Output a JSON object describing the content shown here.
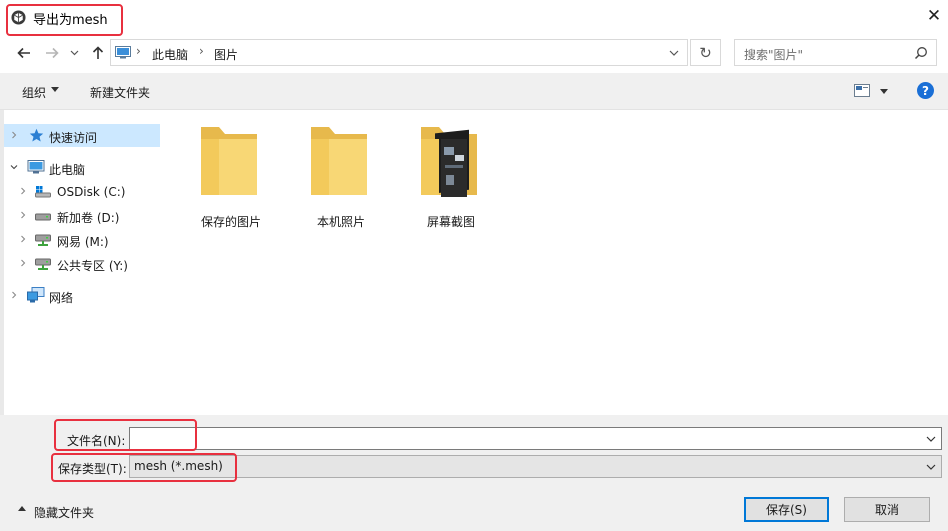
{
  "window": {
    "title": "导出为mesh",
    "close_glyph": "✕"
  },
  "nav": {
    "back_icon": "arrow-left-icon",
    "forward_icon": "arrow-right-icon",
    "up_icon": "arrow-up-icon",
    "breadcrumb": [
      "此电脑",
      "图片"
    ],
    "separator": "›",
    "refresh_glyph": "↻"
  },
  "search": {
    "placeholder": "搜索\"图片\""
  },
  "toolbar": {
    "organize_label": "组织",
    "new_folder_label": "新建文件夹",
    "help_glyph": "?"
  },
  "sidebar": {
    "items": [
      {
        "label": "快速访问",
        "icon": "star-icon",
        "selected": true
      },
      {
        "label": "此电脑",
        "icon": "computer-icon",
        "expanded": true
      },
      {
        "label": "OSDisk (C:)",
        "icon": "system-drive-icon"
      },
      {
        "label": "新加卷 (D:)",
        "icon": "drive-icon"
      },
      {
        "label": "网易 (M:)",
        "icon": "network-drive-icon"
      },
      {
        "label": "公共专区 (Y:)",
        "icon": "network-drive-icon"
      },
      {
        "label": "网络",
        "icon": "network-icon"
      }
    ]
  },
  "files": [
    {
      "name": "保存的图片",
      "icon": "folder-icon"
    },
    {
      "name": "本机照片",
      "icon": "folder-icon"
    },
    {
      "name": "屏幕截图",
      "icon": "folder-screenshots-icon"
    }
  ],
  "form": {
    "filename_label": "文件名(N):",
    "filename_value": "",
    "filetype_label": "保存类型(T):",
    "filetype_value": "mesh (*.mesh)"
  },
  "footer": {
    "hide_folders_label": "隐藏文件夹",
    "save_label": "保存(S)",
    "cancel_label": "取消"
  },
  "colors": {
    "selection": "#cce8ff",
    "annotation": "#e8303f",
    "accent": "#0078d7",
    "folder": "#f8d775"
  }
}
